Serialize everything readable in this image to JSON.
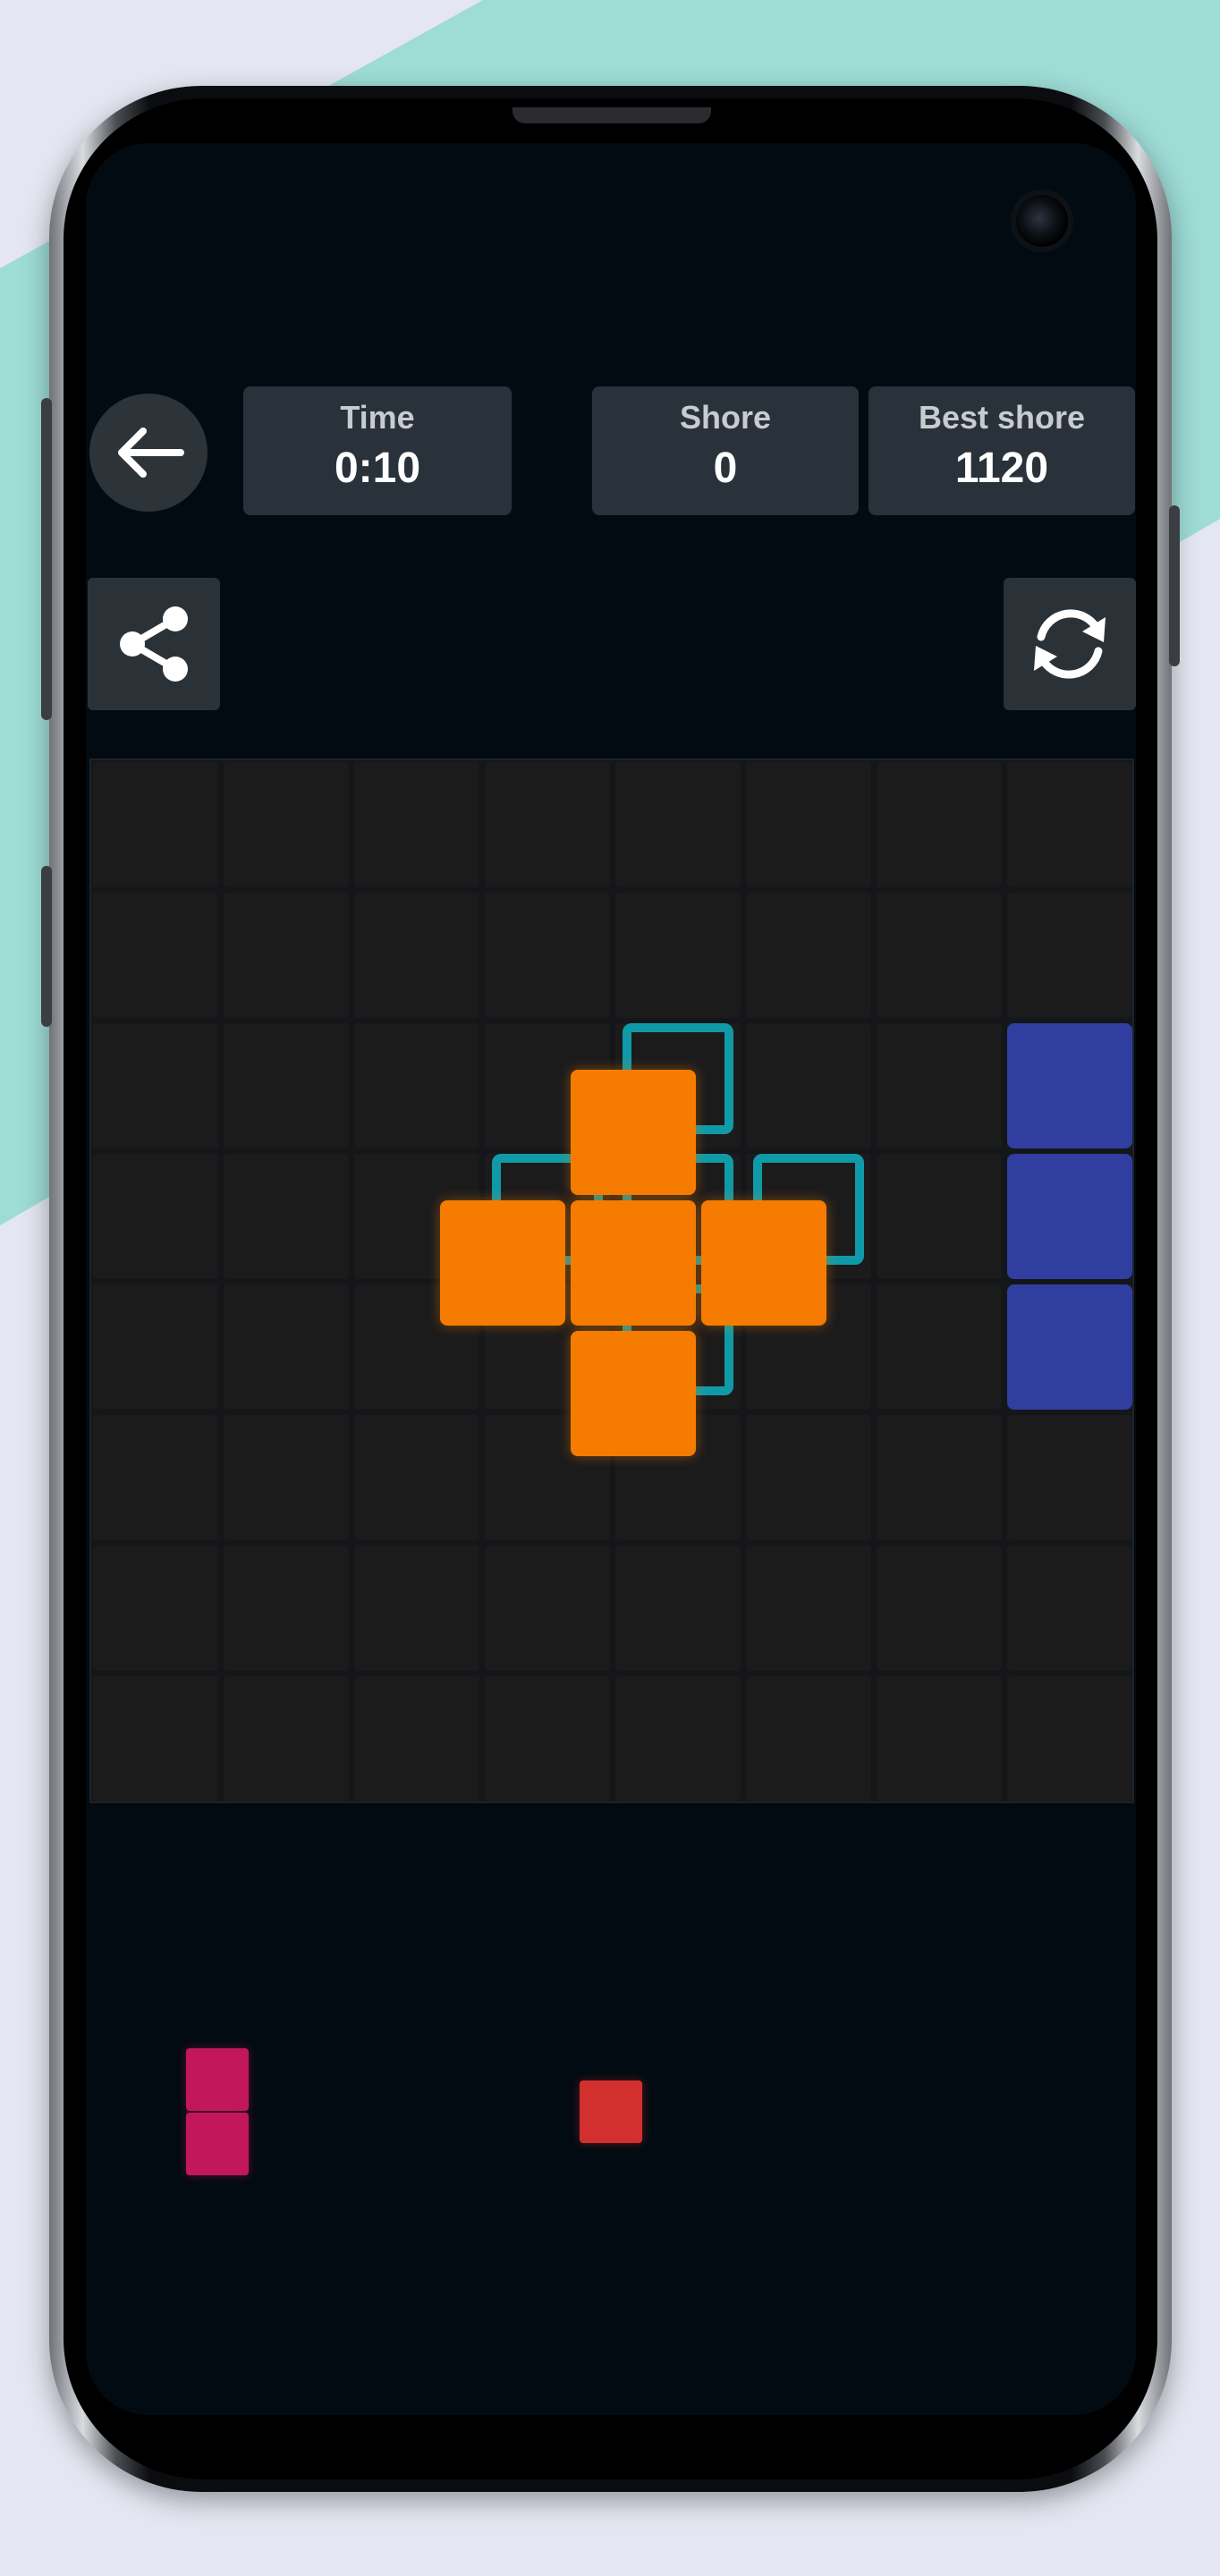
{
  "header": {
    "back_icon": "arrow-left-icon",
    "time": {
      "label": "Time",
      "value": "0:10"
    },
    "score": {
      "label": "Shore",
      "value": "0"
    },
    "best_score": {
      "label": "Best shore",
      "value": "1120"
    }
  },
  "toolbar": {
    "share_icon": "share-icon",
    "restart_icon": "restart-icon"
  },
  "board": {
    "size": 8,
    "empty_color": "#1b1b1c",
    "placed_blocks": [
      {
        "color": "#303f9f",
        "cells": [
          [
            7,
            2
          ],
          [
            7,
            3
          ],
          [
            7,
            4
          ]
        ]
      }
    ],
    "dragging_piece": {
      "color": "#f57c00",
      "shape": "plus"
    },
    "placement_hint_color": "#109aa8"
  },
  "tray": {
    "pieces": [
      {
        "color": "#c2185b",
        "shape": "vertical-2"
      },
      {
        "color": "#d32f2f",
        "shape": "single"
      }
    ]
  },
  "colors": {
    "background": "#e4e6f1",
    "accent_stripe": "#9edcd6",
    "screen": "#030b12",
    "panel": "#29323a"
  }
}
